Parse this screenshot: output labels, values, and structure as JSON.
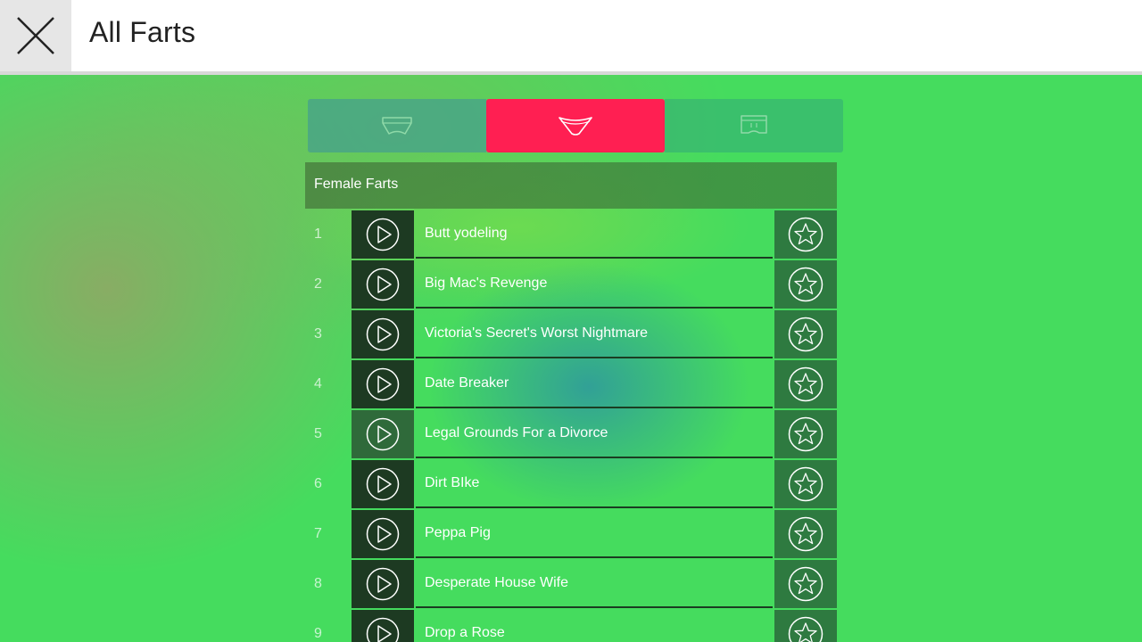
{
  "header": {
    "title": "All Farts",
    "close_icon": "close-icon"
  },
  "tabs": [
    {
      "id": "male",
      "icon": "male-underwear-icon",
      "selected": false
    },
    {
      "id": "female",
      "icon": "female-underwear-icon",
      "selected": true
    },
    {
      "id": "other",
      "icon": "stained-underwear-icon",
      "selected": false
    }
  ],
  "colors": {
    "accent": "#ff1f52",
    "background": "#45dc5e",
    "row_dark": "#1d3a22",
    "fav_bg": "#2e7a40"
  },
  "section": {
    "title": "Female Farts"
  },
  "list": {
    "items": [
      {
        "num": "1",
        "title": "Butt yodeling"
      },
      {
        "num": "2",
        "title": "Big Mac's Revenge"
      },
      {
        "num": "3",
        "title": "Victoria's Secret's Worst Nightmare"
      },
      {
        "num": "4",
        "title": "Date Breaker"
      },
      {
        "num": "5",
        "title": "Legal Grounds For a Divorce"
      },
      {
        "num": "6",
        "title": "Dirt BIke"
      },
      {
        "num": "7",
        "title": "Peppa Pig"
      },
      {
        "num": "8",
        "title": "Desperate House Wife"
      },
      {
        "num": "9",
        "title": "Drop a Rose"
      }
    ]
  }
}
